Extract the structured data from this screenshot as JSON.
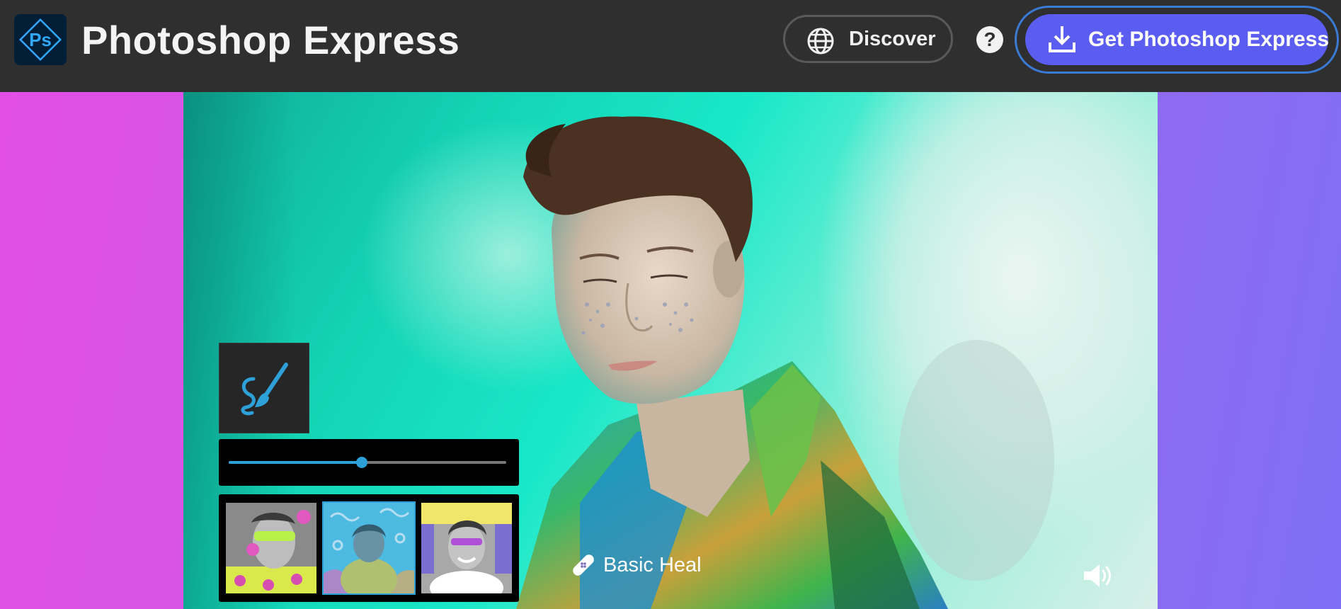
{
  "header": {
    "logo_text": "Ps",
    "app_title": "Photoshop Express",
    "discover_label": "Discover",
    "help_label": "?",
    "get_app_label": "Get Photoshop Express"
  },
  "editor": {
    "tool_icon": "brush-icon",
    "slider_level_percent": 48,
    "thumbnails": [
      {
        "name": "thumbnail-man-green-paint",
        "selected": false
      },
      {
        "name": "thumbnail-woman-yellow-sweater",
        "selected": true
      },
      {
        "name": "thumbnail-smiling-man-city",
        "selected": false
      }
    ],
    "effect_icon": "bandage-icon",
    "effect_label": "Basic Heal",
    "volume_icon": "speaker-icon"
  },
  "colors": {
    "accent": "#5b5df0",
    "focus_ring": "#3a7bd5",
    "slider": "#2da0d8",
    "logo_bg": "#001e36",
    "logo_fg": "#31a8ff"
  }
}
